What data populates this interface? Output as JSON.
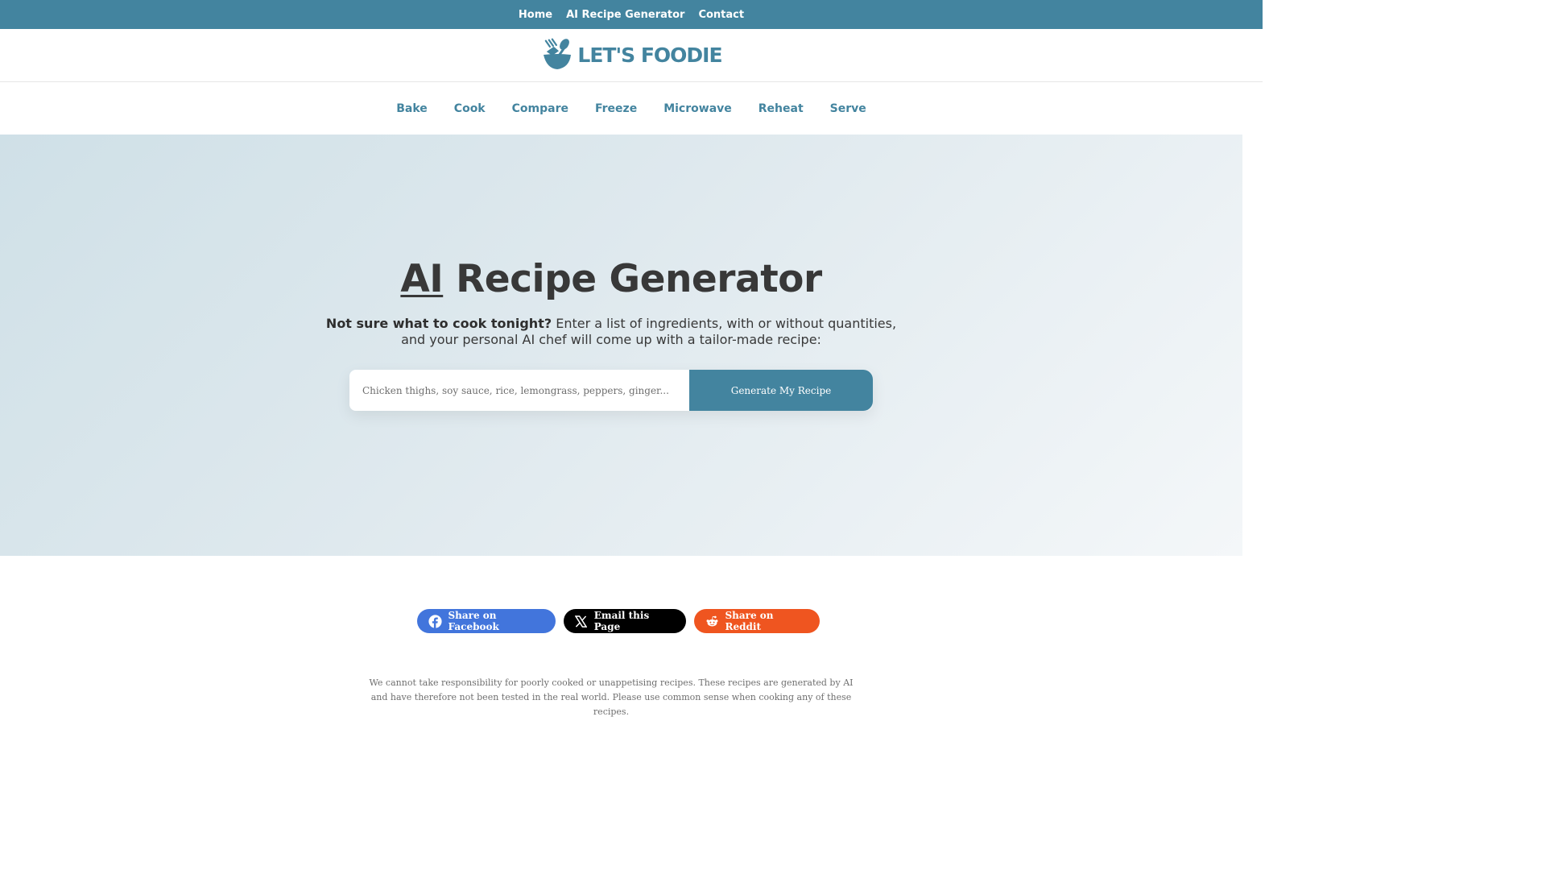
{
  "colors": {
    "brand": "#43849f",
    "facebook": "#4275dc",
    "email": "#000000",
    "reddit": "#ef5520"
  },
  "topbar": {
    "links": [
      {
        "label": "Home"
      },
      {
        "label": "AI Recipe Generator"
      },
      {
        "label": "Contact"
      }
    ]
  },
  "logo": {
    "text": "LET'S FOODIE",
    "icon": "bowl-fork-spoon-icon"
  },
  "categories": [
    {
      "label": "Bake"
    },
    {
      "label": "Cook"
    },
    {
      "label": "Compare"
    },
    {
      "label": "Freeze"
    },
    {
      "label": "Microwave"
    },
    {
      "label": "Reheat"
    },
    {
      "label": "Serve"
    }
  ],
  "hero": {
    "title_ai": "AI",
    "title_rest": " Recipe Generator",
    "subtitle_bold": "Not sure what to cook tonight?",
    "subtitle_rest": " Enter a list of ingredients, with or without quantities, and your personal AI chef will come up with a tailor-made recipe:",
    "input_placeholder": "Chicken thighs, soy sauce, rice, lemongrass, peppers, ginger...",
    "input_value": "",
    "button_label": "Generate My Recipe"
  },
  "share": {
    "facebook": {
      "label": "Share on Facebook",
      "icon": "facebook-icon"
    },
    "email": {
      "label": "Email this Page",
      "icon": "x-icon"
    },
    "reddit": {
      "label": "Share on Reddit",
      "icon": "reddit-icon"
    }
  },
  "disclaimer": "We cannot take responsibility for poorly cooked or unappetising recipes. These recipes are generated by AI and have therefore not been tested in the real world. Please use common sense when cooking any of these recipes."
}
